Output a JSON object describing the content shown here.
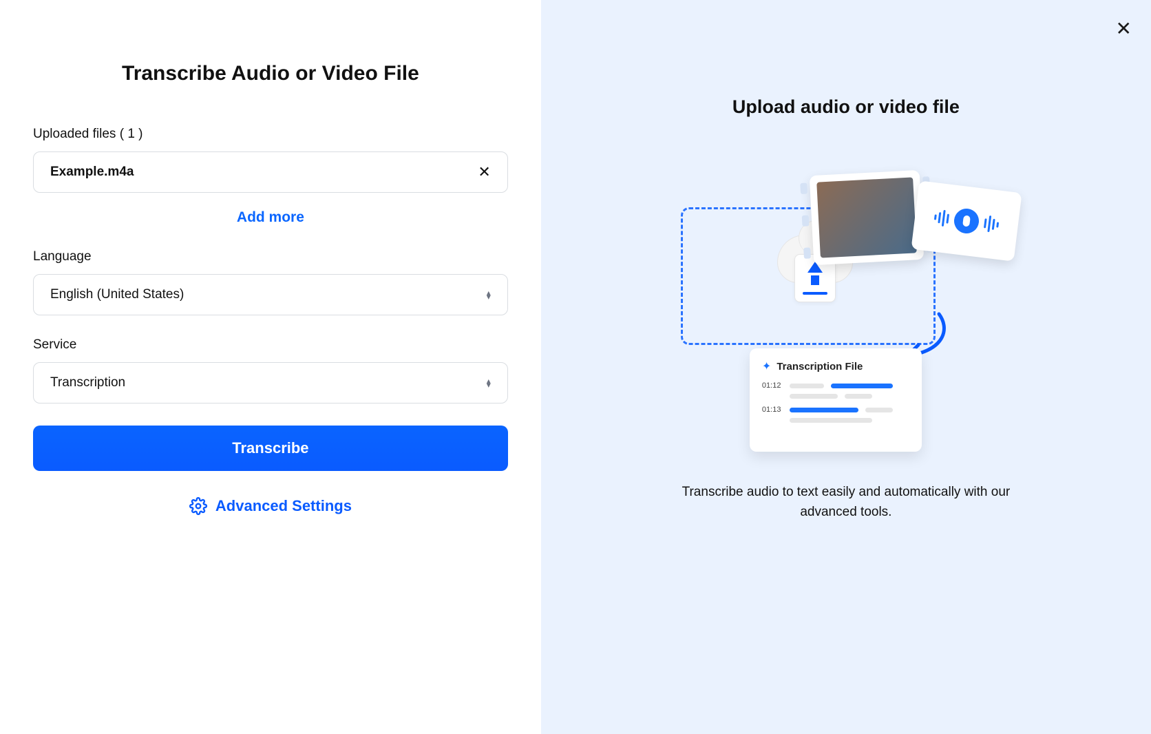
{
  "left": {
    "title": "Transcribe Audio or Video File",
    "uploaded_label_prefix": "Uploaded files",
    "uploaded_count": "1",
    "file_name": "Example.m4a",
    "add_more": "Add more",
    "language_label": "Language",
    "language_value": "English (United States)",
    "service_label": "Service",
    "service_value": "Transcription",
    "transcribe_btn": "Transcribe",
    "advanced": "Advanced Settings"
  },
  "right": {
    "title": "Upload audio or video file",
    "trans_card_title": "Transcription File",
    "ts1": "01:12",
    "ts2": "01:13",
    "caption": "Transcribe audio to text easily and automatically with our advanced tools."
  }
}
